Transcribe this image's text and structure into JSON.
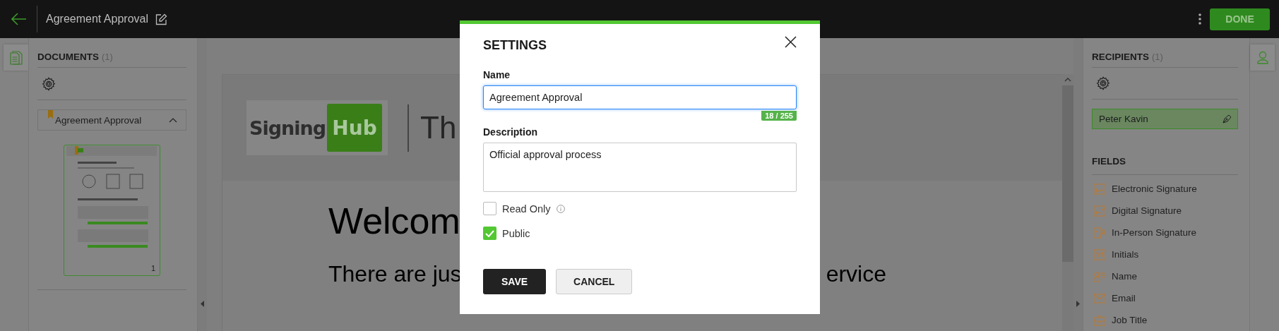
{
  "top_bar": {
    "title": "Agreement Approval",
    "done_button": "DONE"
  },
  "documents_panel": {
    "heading": "DOCUMENTS",
    "count": "(1)",
    "documents": [
      {
        "name": "Agreement Approval",
        "expanded": true,
        "page_number": "1"
      }
    ]
  },
  "document_view": {
    "logo": {
      "word_1": "Signing",
      "word_2": "Hub"
    },
    "header_text": "Th",
    "heading": "Welcom",
    "line_start": "There are jus",
    "line_end": "ervice"
  },
  "recipients_panel": {
    "heading": "RECIPIENTS",
    "count": "(1)",
    "recipients": [
      {
        "name": "Peter Kavin",
        "selected": true
      }
    ]
  },
  "fields_panel": {
    "heading": "FIELDS",
    "fields": [
      {
        "label": "Electronic Signature",
        "kind": "electronic_signature"
      },
      {
        "label": "Digital Signature",
        "kind": "digital_signature"
      },
      {
        "label": "In-Person Signature",
        "kind": "in_person_signature"
      },
      {
        "label": "Initials",
        "kind": "initials"
      },
      {
        "label": "Name",
        "kind": "name"
      },
      {
        "label": "Email",
        "kind": "email"
      },
      {
        "label": "Job Title",
        "kind": "job_title"
      }
    ]
  },
  "settings_dialog": {
    "title": "SETTINGS",
    "name_label": "Name",
    "name_value": "Agreement Approval",
    "name_counter": "18 / 255",
    "description_label": "Description",
    "description_value": "Official approval process",
    "options": [
      {
        "label": "Read Only",
        "checked": false,
        "info": true
      },
      {
        "label": "Public",
        "checked": true
      }
    ],
    "buttons": [
      {
        "label": "SAVE",
        "kind": "primary"
      },
      {
        "label": "CANCEL",
        "kind": "secondary"
      }
    ]
  }
}
